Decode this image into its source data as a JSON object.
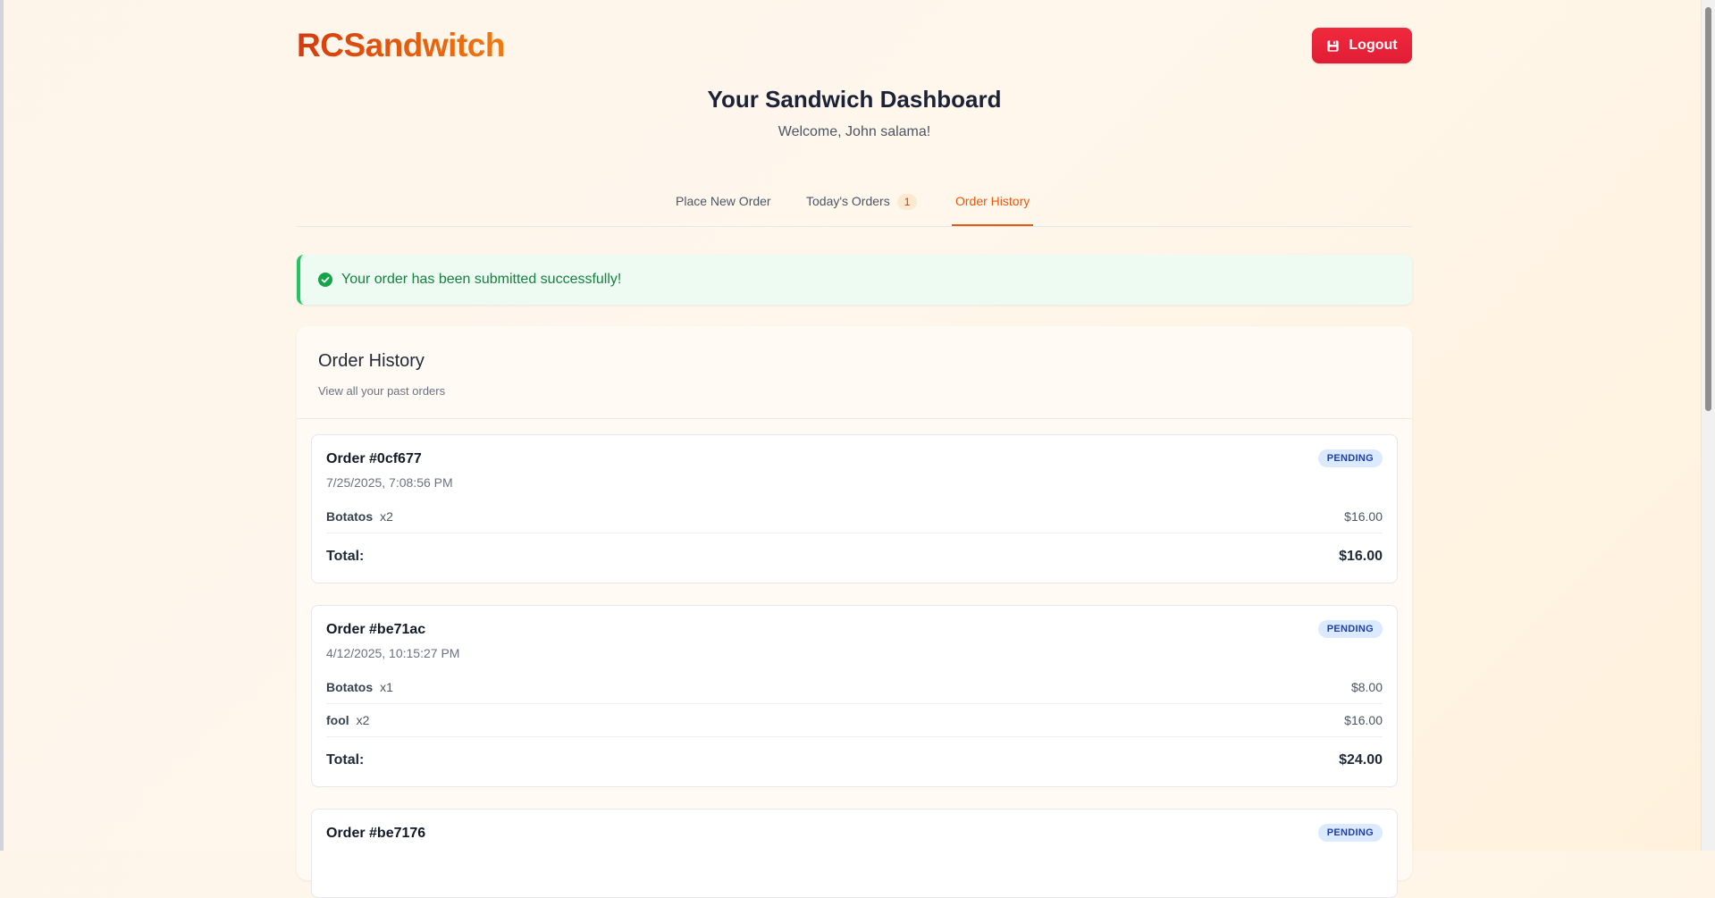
{
  "app": {
    "brand": "RCSandwitch",
    "logout_label": "Logout"
  },
  "header": {
    "title": "Your Sandwich Dashboard",
    "welcome": "Welcome, John salama!"
  },
  "tabs": [
    {
      "label": "Place New Order",
      "badge": null,
      "active": false
    },
    {
      "label": "Today's Orders",
      "badge": "1",
      "active": false
    },
    {
      "label": "Order History",
      "badge": null,
      "active": true
    }
  ],
  "alert": {
    "message": "Your order has been submitted successfully!",
    "type": "success"
  },
  "history": {
    "title": "Order History",
    "subtitle": "View all your past orders",
    "total_label": "Total:",
    "orders": [
      {
        "id": "Order #0cf677",
        "date": "7/25/2025, 7:08:56 PM",
        "status": "PENDING",
        "items": [
          {
            "name": "Botatos",
            "qty": "x2",
            "price": "$16.00"
          }
        ],
        "total": "$16.00"
      },
      {
        "id": "Order #be71ac",
        "date": "4/12/2025, 10:15:27 PM",
        "status": "PENDING",
        "items": [
          {
            "name": "Botatos",
            "qty": "x1",
            "price": "$8.00"
          },
          {
            "name": "fool",
            "qty": "x2",
            "price": "$16.00"
          }
        ],
        "total": "$24.00"
      },
      {
        "id": "Order #be7176",
        "status": "PENDING"
      }
    ]
  },
  "colors": {
    "accent": "#ea580c",
    "logout": "#e11d35",
    "success": "#22c55e",
    "status_bg": "#dbeafe"
  },
  "icons": {
    "logout": "logout-icon",
    "success": "check-circle-icon"
  }
}
